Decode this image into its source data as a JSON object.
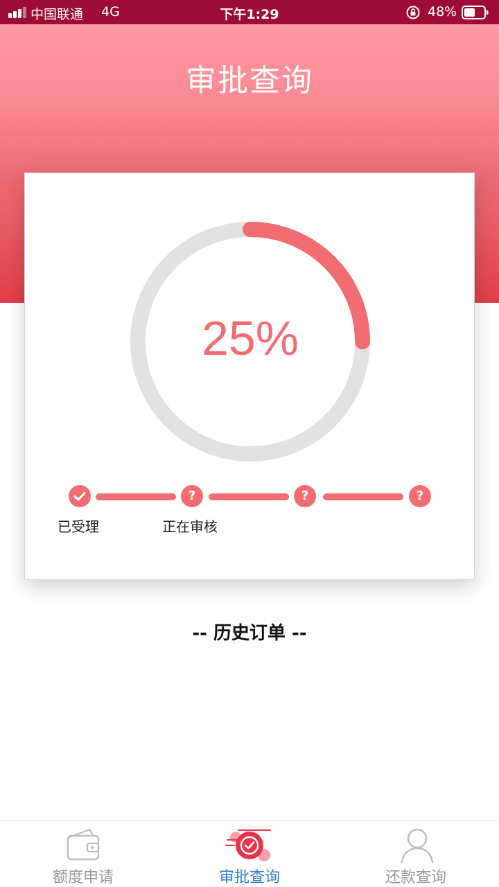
{
  "status_bar": {
    "carrier": "中国联通",
    "network": "4G",
    "time": "下午1:29",
    "battery": "48%"
  },
  "header": {
    "title": "审批查询"
  },
  "progress": {
    "value_text": "25%",
    "fraction": 0.25,
    "track_color": "#e2e2e2",
    "fill_color": "#f16d72"
  },
  "steps": [
    {
      "icon": "check-icon",
      "label": "已受理",
      "status": "done"
    },
    {
      "icon": "question-icon",
      "label": "正在审核",
      "status": "pending"
    },
    {
      "icon": "question-icon",
      "label": "",
      "status": "pending"
    },
    {
      "icon": "question-icon",
      "label": "",
      "status": "pending"
    }
  ],
  "history": {
    "title": "-- 历史订单 --"
  },
  "tabs": [
    {
      "label": "额度申请",
      "icon": "wallet-icon",
      "active": false
    },
    {
      "label": "审批查询",
      "icon": "approval-check-icon",
      "active": true
    },
    {
      "label": "还款查询",
      "icon": "user-icon",
      "active": false
    }
  ],
  "colors": {
    "status_bar": "#9e0c35",
    "accent": "#f16d72",
    "tab_active": "#2f7fd8",
    "tab_inactive": "#9a9a9a"
  }
}
